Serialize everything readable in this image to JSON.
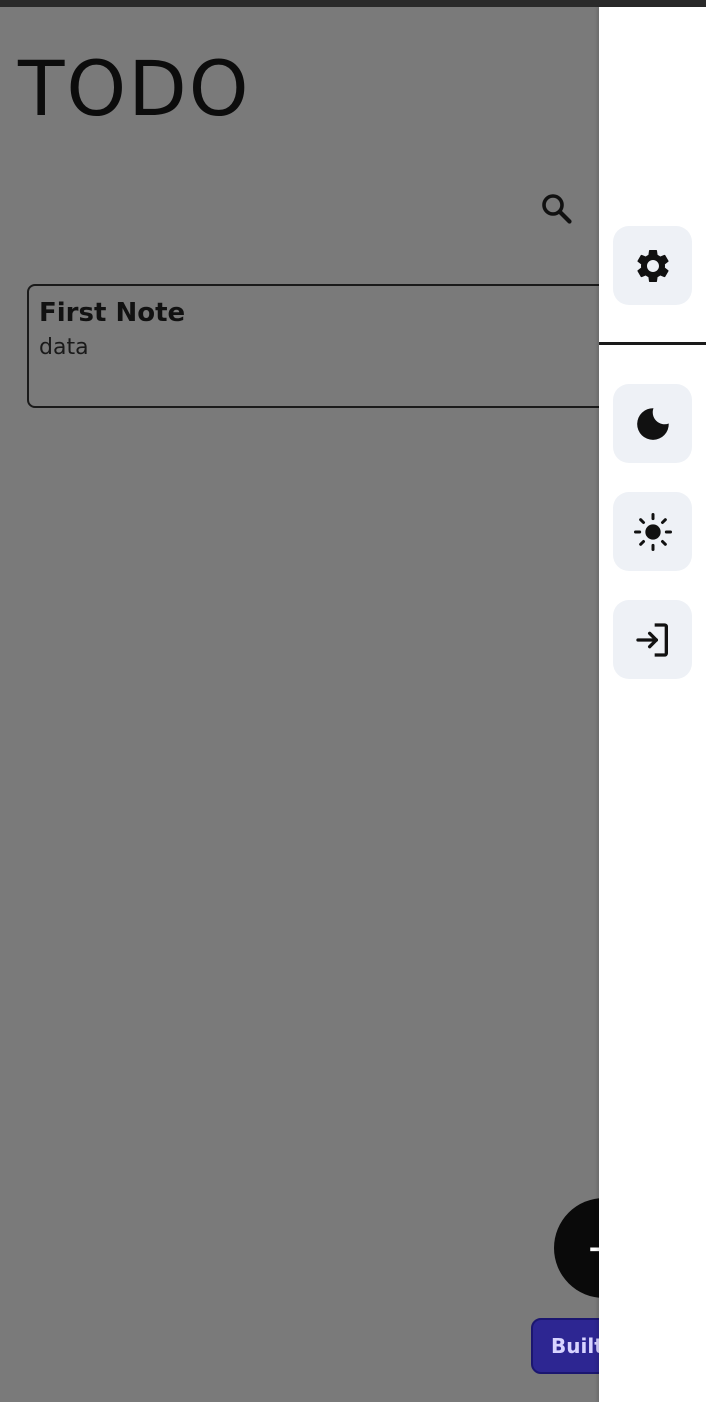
{
  "app": {
    "title": "TODO"
  },
  "toolbar": {
    "search_icon": "search-icon"
  },
  "notes": [
    {
      "title": "First Note",
      "body": "data"
    }
  ],
  "fab": {
    "label": "+",
    "icon": "plus-icon"
  },
  "badge": {
    "label": "Built"
  },
  "drawer": {
    "items": [
      {
        "icon": "gear-icon",
        "name": "settings"
      },
      {
        "icon": "moon-icon",
        "name": "dark-mode"
      },
      {
        "icon": "sun-icon",
        "name": "light-mode"
      },
      {
        "icon": "login-icon",
        "name": "login"
      }
    ]
  },
  "colors": {
    "overlay": "#7a7a7a",
    "drawer_bg": "#ffffff",
    "drawer_button_bg": "#eef1f6",
    "badge_bg": "#2d2692",
    "fab_bg": "#0a0a0a"
  }
}
